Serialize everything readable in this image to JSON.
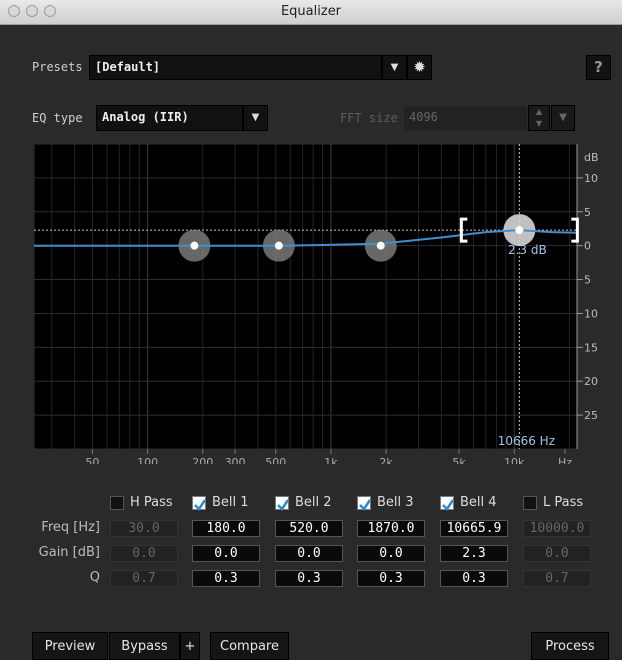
{
  "window": {
    "title": "Equalizer"
  },
  "presets": {
    "label": "Presets",
    "value": "[Default]",
    "help": "?"
  },
  "eq": {
    "type_label": "EQ type",
    "type_value": "Analog (IIR)",
    "fft_label": "FFT size",
    "fft_value": "4096"
  },
  "graph": {
    "db_unit": "dB",
    "db_ticks": [
      "10",
      "5",
      "0",
      "5",
      "10",
      "15",
      "20",
      "25"
    ],
    "freq_ticks": [
      "50",
      "100",
      "200",
      "300",
      "500",
      "1k",
      "2k",
      "5k",
      "10k",
      "Hz"
    ],
    "readout_db": "2.3 dB",
    "readout_hz": "10666 Hz",
    "curve_color": "#3f8fd0"
  },
  "chart_data": {
    "type": "line",
    "xlabel": "Hz",
    "ylabel": "dB",
    "xscale": "log",
    "ylim": [
      -30,
      15
    ],
    "x": [
      30,
      60,
      100,
      180,
      300,
      520,
      900,
      1870,
      4000,
      7000,
      10666,
      16000,
      22000
    ],
    "series": [
      {
        "values": [
          0,
          0,
          0,
          0,
          0,
          0,
          0.1,
          0.3,
          1.2,
          2.0,
          2.3,
          2.0,
          1.9
        ]
      }
    ],
    "points": [
      {
        "band": "Bell 1",
        "freq": 180,
        "gain": 0.0
      },
      {
        "band": "Bell 2",
        "freq": 520,
        "gain": 0.0
      },
      {
        "band": "Bell 3",
        "freq": 1870,
        "gain": 0.0
      },
      {
        "band": "Bell 4",
        "freq": 10665.9,
        "gain": 2.3
      }
    ]
  },
  "bands": [
    {
      "name": "H Pass",
      "enabled": false,
      "freq": "30.0",
      "gain": "0.0",
      "q": "0.7"
    },
    {
      "name": "Bell 1",
      "enabled": true,
      "freq": "180.0",
      "gain": "0.0",
      "q": "0.3"
    },
    {
      "name": "Bell 2",
      "enabled": true,
      "freq": "520.0",
      "gain": "0.0",
      "q": "0.3"
    },
    {
      "name": "Bell 3",
      "enabled": true,
      "freq": "1870.0",
      "gain": "0.0",
      "q": "0.3"
    },
    {
      "name": "Bell 4",
      "enabled": true,
      "freq": "10665.9",
      "gain": "2.3",
      "q": "0.3"
    },
    {
      "name": "L Pass",
      "enabled": false,
      "freq": "10000.0",
      "gain": "0.0",
      "q": "0.7"
    }
  ],
  "rows": {
    "freq": "Freq [Hz]",
    "gain": "Gain [dB]",
    "q": "Q"
  },
  "buttons": {
    "preview": "Preview",
    "bypass": "Bypass",
    "plus": "+",
    "compare": "Compare",
    "process": "Process"
  }
}
